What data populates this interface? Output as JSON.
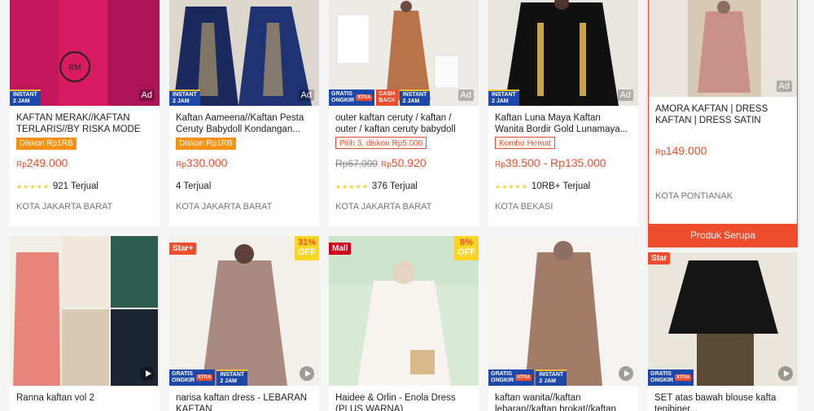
{
  "products_row1": [
    {
      "title": "KAFTAN MERAK//KAFTAN TERLARIS//BY RISKA MODE",
      "promo": "Diskon Rp1RB",
      "promo_style": "fill",
      "price_prefix": "Rp",
      "price": "249.000",
      "strike": "",
      "sold": "921 Terjual",
      "stars": true,
      "location": "KOTA JAKARTA BARAT",
      "ad": "Ad",
      "badges": [
        "instant"
      ]
    },
    {
      "title": "Kaftan Aameena//Kaftan Pesta Ceruty Babydoll Kondangan...",
      "promo": "Diskon Rp1RB",
      "promo_style": "fill",
      "price_prefix": "Rp",
      "price": "330.000",
      "strike": "",
      "sold": "4 Terjual",
      "stars": false,
      "location": "KOTA JAKARTA BARAT",
      "ad": "Ad",
      "badges": [
        "instant"
      ]
    },
    {
      "title": "outer kaftan ceruty / kaftan / outer / kaftan ceruty babydoll",
      "promo": "Pilih 3, diskon Rp5.000",
      "promo_style": "outline",
      "price_prefix": "Rp",
      "price": "50.920",
      "strike": "Rp67.000",
      "sold": "376 Terjual",
      "stars": true,
      "location": "KOTA JAKARTA BARAT",
      "ad": "Ad",
      "badges": [
        "gratis",
        "cash",
        "instant"
      ]
    },
    {
      "title": "Kaftan Luna Maya Kaftan Wanita Bordir Gold Lunamaya...",
      "promo": "Kombo Hemat",
      "promo_style": "outline",
      "price_prefix": "Rp",
      "price": "39.500 - Rp135.000",
      "strike": "",
      "sold": "10RB+ Terjual",
      "stars": true,
      "location": "KOTA BEKASI",
      "ad": "Ad",
      "badges": [
        "instant"
      ]
    },
    {
      "title": "AMORA KAFTAN | DRESS KAFTAN | DRESS SATIN",
      "promo": "",
      "promo_style": "",
      "price_prefix": "Rp",
      "price": "149.000",
      "strike": "",
      "sold": "",
      "stars": false,
      "location": "KOTA PONTIANAK",
      "ad": "Ad",
      "badges": [],
      "similar": "Produk Serupa"
    }
  ],
  "products_row2": [
    {
      "title": "Ranna kaftan vol 2",
      "tag": "",
      "discount": "",
      "badges": []
    },
    {
      "title": "narisa kaftan dress - LEBARAN KAFTAN",
      "tag": "Star+",
      "discount": "31%",
      "badges": [
        "gratis",
        "instant"
      ]
    },
    {
      "title": "Haidee & Orlin - Enola Dress (PLUS WARNA)",
      "tag": "Mall",
      "discount": "8%",
      "badges": []
    },
    {
      "title": "kaftan wanita//kaftan lebaran//kaftan brokat//kaftan",
      "tag": "",
      "discount": "",
      "badges": [
        "gratis",
        "instant"
      ]
    },
    {
      "title": "SET atas bawah blouse kafta tenibiner...",
      "tag": "Star",
      "discount": "",
      "badges": [
        "gratis"
      ]
    }
  ],
  "labels": {
    "off": "OFF",
    "instant_1": "INSTANT",
    "instant_2": "2 JAM",
    "gratis_1": "GRATIS",
    "gratis_2": "ONGKIR",
    "gratis_x": "XTRA",
    "cash_1": "CASH",
    "cash_2": "BACK"
  },
  "colors": {
    "accent": "#ee4d2d",
    "promo_fill": "#f69113",
    "badge_blue": "#1d47a8"
  }
}
